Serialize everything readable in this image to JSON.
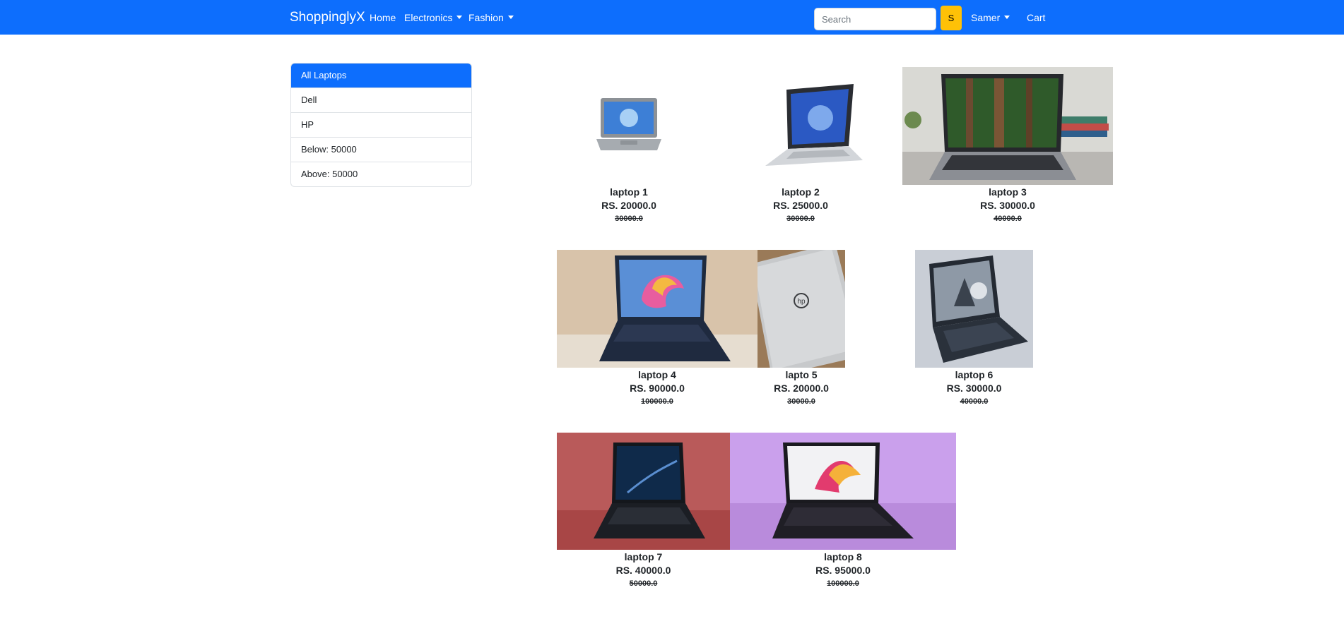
{
  "navbar": {
    "brand": "ShoppinglyX",
    "links": {
      "home": "Home",
      "electronics": "Electronics",
      "fashion": "Fashion",
      "user": "Samer",
      "cart": "Cart"
    },
    "search_placeholder": "Search",
    "search_button": "S"
  },
  "sidebar": {
    "items": [
      "All Laptops",
      "Dell",
      "HP",
      "Below: 50000",
      "Above: 50000"
    ]
  },
  "products": [
    {
      "name": "laptop 1",
      "price": "RS. 20000.0",
      "old_price": "30000.0"
    },
    {
      "name": "laptop 2",
      "price": "RS. 25000.0",
      "old_price": "30000.0"
    },
    {
      "name": "laptop 3",
      "price": "RS. 30000.0",
      "old_price": "40000.0"
    },
    {
      "name": "laptop 4",
      "price": "RS. 90000.0",
      "old_price": "100000.0"
    },
    {
      "name": "lapto 5",
      "price": "RS. 20000.0",
      "old_price": "30000.0"
    },
    {
      "name": "laptop 6",
      "price": "RS. 30000.0",
      "old_price": "40000.0"
    },
    {
      "name": "laptop 7",
      "price": "RS. 40000.0",
      "old_price": "50000.0"
    },
    {
      "name": "laptop 8",
      "price": "RS. 95000.0",
      "old_price": "100000.0"
    }
  ],
  "colors": {
    "primary": "#0d6efd",
    "search_button": "#ffc107",
    "border": "#dee2e6"
  }
}
